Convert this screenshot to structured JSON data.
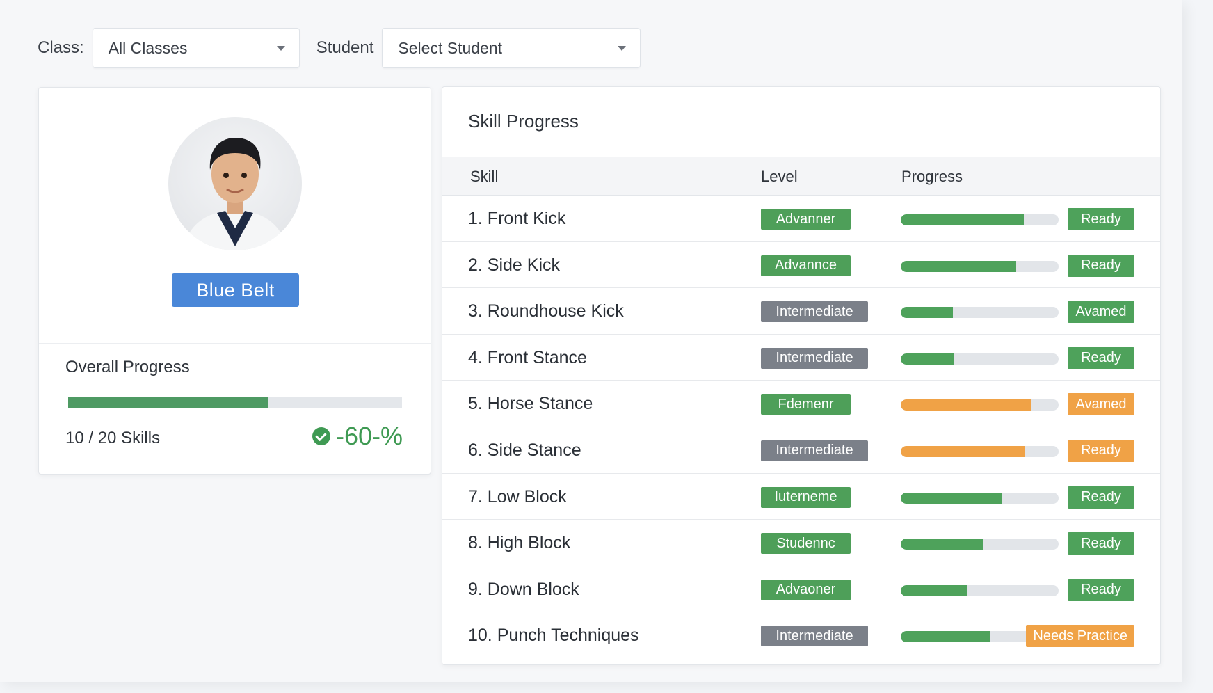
{
  "filters": {
    "class_label": "Class:",
    "class_value": "All Classes",
    "student_label": "Student",
    "student_value": "Select Student"
  },
  "profile": {
    "belt": "Blue Belt",
    "overall_title": "Overall Progress",
    "overall_progress_fraction": 0.6,
    "skills_count": "10 / 20 Skills",
    "percent": "-60-%"
  },
  "skill_progress": {
    "title": "Skill Progress",
    "headers": {
      "skill": "Skill",
      "level": "Level",
      "progress": "Progress"
    },
    "rows": [
      {
        "skill": "1. Front Kick",
        "level": "Advanner",
        "level_color": "green",
        "progress": 0.78,
        "bar_color": "green",
        "status": "Ready",
        "status_color": "green"
      },
      {
        "skill": "2. Side Kick",
        "level": "Advannce",
        "level_color": "green",
        "progress": 0.73,
        "bar_color": "green",
        "status": "Ready",
        "status_color": "green"
      },
      {
        "skill": "3. Roundhouse Kick",
        "level": "Intermediate",
        "level_color": "gray",
        "progress": 0.33,
        "bar_color": "green",
        "status": "Avamed",
        "status_color": "green"
      },
      {
        "skill": "4. Front Stance",
        "level": "Intermediate",
        "level_color": "gray",
        "progress": 0.34,
        "bar_color": "green",
        "status": "Ready",
        "status_color": "green"
      },
      {
        "skill": "5. Horse Stance",
        "level": "Fdemenr",
        "level_color": "green",
        "progress": 0.83,
        "bar_color": "orange",
        "status": "Avamed",
        "status_color": "orange"
      },
      {
        "skill": "6. Side Stance",
        "level": "Intermediate",
        "level_color": "gray",
        "progress": 0.79,
        "bar_color": "orange",
        "status": "Ready",
        "status_color": "orange"
      },
      {
        "skill": "7. Low Block",
        "level": "Iuterneme",
        "level_color": "green",
        "progress": 0.64,
        "bar_color": "green",
        "status": "Ready",
        "status_color": "green"
      },
      {
        "skill": "8. High Block",
        "level": "Studennc",
        "level_color": "green",
        "progress": 0.52,
        "bar_color": "green",
        "status": "Ready",
        "status_color": "green"
      },
      {
        "skill": "9. Down Block",
        "level": "Advaoner",
        "level_color": "green",
        "progress": 0.42,
        "bar_color": "green",
        "status": "Ready",
        "status_color": "green"
      },
      {
        "skill": "10. Punch Techniques",
        "level": "Intermediate",
        "level_color": "gray",
        "progress": 0.57,
        "bar_color": "green",
        "status": "Needs Practice",
        "status_color": "orange"
      }
    ]
  },
  "colors": {
    "green": "#4ea25b",
    "orange": "#f0a246",
    "gray": "#7b8089",
    "blue": "#4a87d8"
  }
}
